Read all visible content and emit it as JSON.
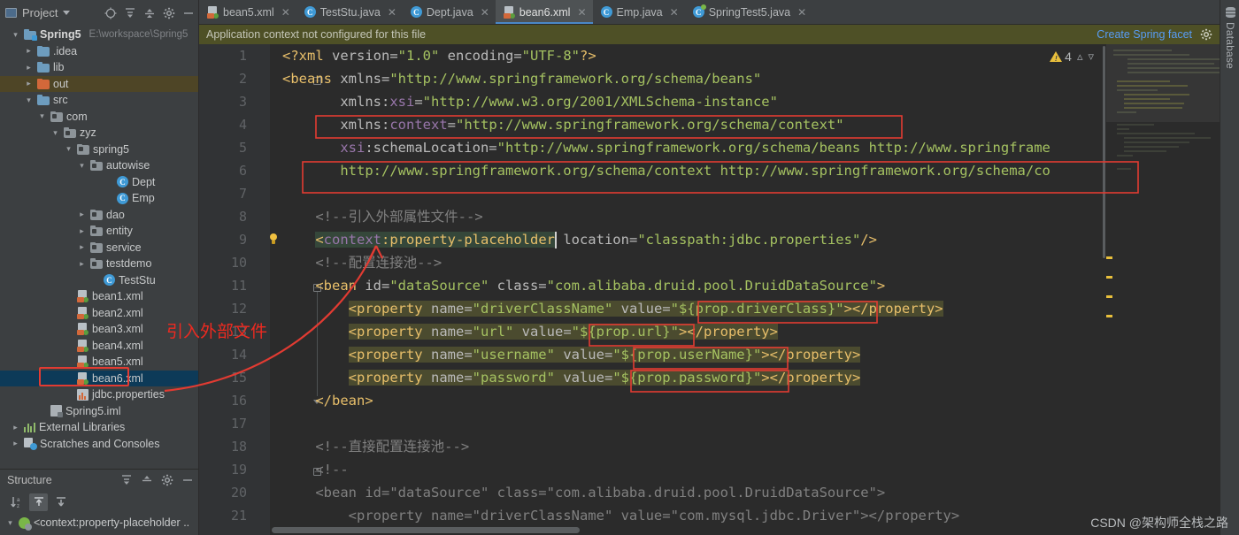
{
  "window": {
    "project_panel_title": "Project",
    "structure_panel_title": "Structure",
    "right_rail_label": "Database",
    "watermark": "CSDN @架构师全栈之路"
  },
  "project_tree": {
    "root": {
      "label": "Spring5",
      "path": "E:\\workspace\\Spring5"
    },
    "items": [
      {
        "label": ".idea",
        "indent": 1,
        "arrow": "collapsed",
        "icon": "folder",
        "selected": "none"
      },
      {
        "label": "lib",
        "indent": 1,
        "arrow": "collapsed",
        "icon": "folder",
        "selected": "none"
      },
      {
        "label": "out",
        "indent": 1,
        "arrow": "collapsed",
        "icon": "folder-orange",
        "selected": "row-highlight"
      },
      {
        "label": "src",
        "indent": 1,
        "arrow": "expanded",
        "icon": "folder",
        "selected": "none"
      },
      {
        "label": "com",
        "indent": 2,
        "arrow": "expanded",
        "icon": "package",
        "selected": "none"
      },
      {
        "label": "zyz",
        "indent": 3,
        "arrow": "expanded",
        "icon": "package",
        "selected": "none"
      },
      {
        "label": "spring5",
        "indent": 4,
        "arrow": "expanded",
        "icon": "package",
        "selected": "none"
      },
      {
        "label": "autowise",
        "indent": 5,
        "arrow": "expanded",
        "icon": "package",
        "selected": "none"
      },
      {
        "label": "Dept",
        "indent": 7,
        "arrow": "none",
        "icon": "class",
        "selected": "none"
      },
      {
        "label": "Emp",
        "indent": 7,
        "arrow": "none",
        "icon": "class",
        "selected": "none"
      },
      {
        "label": "dao",
        "indent": 5,
        "arrow": "collapsed",
        "icon": "package",
        "selected": "none"
      },
      {
        "label": "entity",
        "indent": 5,
        "arrow": "collapsed",
        "icon": "package",
        "selected": "none"
      },
      {
        "label": "service",
        "indent": 5,
        "arrow": "collapsed",
        "icon": "package",
        "selected": "none"
      },
      {
        "label": "testdemo",
        "indent": 5,
        "arrow": "collapsed",
        "icon": "package",
        "selected": "none"
      },
      {
        "label": "TestStu",
        "indent": 6,
        "arrow": "none",
        "icon": "class",
        "selected": "none"
      },
      {
        "label": "bean1.xml",
        "indent": 4,
        "arrow": "none",
        "icon": "xml",
        "selected": "none"
      },
      {
        "label": "bean2.xml",
        "indent": 4,
        "arrow": "none",
        "icon": "xml",
        "selected": "none"
      },
      {
        "label": "bean3.xml",
        "indent": 4,
        "arrow": "none",
        "icon": "xml",
        "selected": "none"
      },
      {
        "label": "bean4.xml",
        "indent": 4,
        "arrow": "none",
        "icon": "xml",
        "selected": "none"
      },
      {
        "label": "bean5.xml",
        "indent": 4,
        "arrow": "none",
        "icon": "xml",
        "selected": "none"
      },
      {
        "label": "bean6.xml",
        "indent": 4,
        "arrow": "none",
        "icon": "xml",
        "selected": "row-selected"
      },
      {
        "label": "jdbc.properties",
        "indent": 4,
        "arrow": "none",
        "icon": "properties",
        "selected": "none"
      },
      {
        "label": "Spring5.iml",
        "indent": 2,
        "arrow": "none",
        "icon": "iml",
        "selected": "none"
      },
      {
        "label": "External Libraries",
        "indent": 0,
        "arrow": "collapsed",
        "icon": "library",
        "selected": "none"
      },
      {
        "label": "Scratches and Consoles",
        "indent": 0,
        "arrow": "collapsed",
        "icon": "scratches",
        "selected": "none"
      }
    ]
  },
  "editor_tabs": [
    {
      "label": "bean5.xml",
      "icon": "xml-file-icon",
      "active": false
    },
    {
      "label": "TestStu.java",
      "icon": "java-class-icon",
      "active": false
    },
    {
      "label": "Dept.java",
      "icon": "java-class-icon",
      "active": false
    },
    {
      "label": "bean6.xml",
      "icon": "xml-file-icon",
      "active": true
    },
    {
      "label": "Emp.java",
      "icon": "java-class-icon",
      "active": false
    },
    {
      "label": "SpringTest5.java",
      "icon": "spring-class-icon",
      "active": false
    }
  ],
  "notification": {
    "message": "Application context not configured for this file",
    "action_link": "Create Spring facet",
    "settings_icon": "gear-icon"
  },
  "inspection": {
    "warning_count": "4",
    "up_arrow": "⌃",
    "down_arrow": "⌄"
  },
  "code": {
    "line_numbers": [
      "1",
      "2",
      "3",
      "4",
      "5",
      "6",
      "7",
      "8",
      "9",
      "10",
      "11",
      "12",
      "13",
      "14",
      "15",
      "16",
      "17",
      "18",
      "19",
      "20",
      "21"
    ],
    "lines": [
      "<?xml version=\"1.0\" encoding=\"UTF-8\"?>",
      "<beans xmlns=\"http://www.springframework.org/schema/beans\"",
      "       xmlns:xsi=\"http://www.w3.org/2001/XMLSchema-instance\"",
      "       xmlns:context=\"http://www.springframework.org/schema/context\"",
      "       xsi:schemaLocation=\"http://www.springframework.org/schema/beans http://www.springframe",
      "       http://www.springframework.org/schema/context http://www.springframework.org/schema/co",
      "",
      "    <!--引入外部属性文件-->",
      "    <context:property-placeholder location=\"classpath:jdbc.properties\"/>",
      "    <!--配置连接池-->",
      "    <bean id=\"dataSource\" class=\"com.alibaba.druid.pool.DruidDataSource\">",
      "        <property name=\"driverClassName\" value=\"${prop.driverClass}\"></property>",
      "        <property name=\"url\" value=\"${prop.url}\"></property>",
      "        <property name=\"username\" value=\"${prop.userName}\"></property>",
      "        <property name=\"password\" value=\"${prop.password}\"></property>",
      "    </bean>",
      "",
      "    <!--直接配置连接池-->",
      "    <!--",
      "    <bean id=\"dataSource\" class=\"com.alibaba.druid.pool.DruidDataSource\">",
      "        <property name=\"driverClassName\" value=\"com.mysql.jdbc.Driver\"></property>"
    ]
  },
  "structure": {
    "title": "Structure",
    "sort_icon": "sort-alphabetically-icon",
    "expand_icon": "expand-all-icon",
    "collapse_icon": "collapse-all-icon",
    "rows": [
      {
        "label": "<context:property-placeholder .."
      }
    ]
  },
  "annotation": {
    "text": "引入外部文件",
    "color": "#ee2a20"
  },
  "colors": {
    "accent_tab": "#4a88c7",
    "notif_bg": "#4e5026",
    "annotation_red": "#ee2a20",
    "selection_blue": "#0d3a58",
    "editor_bg": "#2b2b2b",
    "panel_bg": "#3c3f41"
  }
}
